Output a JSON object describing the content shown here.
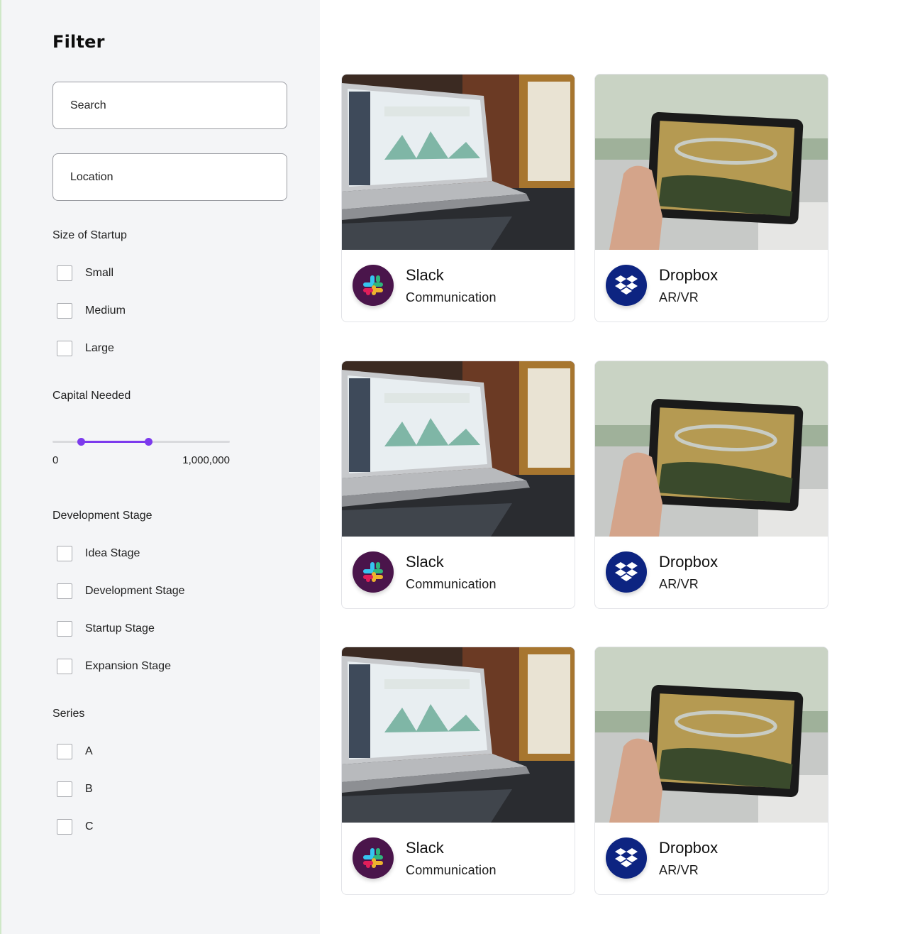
{
  "filter": {
    "title": "Filter",
    "search_placeholder": "Search",
    "location_placeholder": "Location"
  },
  "size_section": {
    "label": "Size of Startup",
    "options": [
      "Small",
      "Medium",
      "Large"
    ]
  },
  "capital_section": {
    "label": "Capital Needed",
    "min_label": "0",
    "max_label": "1,000,000",
    "selected_low_fraction": 0.16,
    "selected_high_fraction": 0.54,
    "accent_color": "#7c3aed"
  },
  "stage_section": {
    "label": "Development Stage",
    "options": [
      "Idea Stage",
      "Development Stage",
      "Startup Stage",
      "Expansion Stage"
    ]
  },
  "series_section": {
    "label": "Series",
    "options": [
      "A",
      "B",
      "C"
    ]
  },
  "cards": [
    {
      "name": "Slack",
      "category": "Communication",
      "logo": "slack-logo",
      "image": "laptop-dashboard-photo"
    },
    {
      "name": "Dropbox",
      "category": "AR/VR",
      "logo": "dropbox-logo",
      "image": "tablet-ar-photo"
    },
    {
      "name": "Slack",
      "category": "Communication",
      "logo": "slack-logo",
      "image": "laptop-dashboard-photo"
    },
    {
      "name": "Dropbox",
      "category": "AR/VR",
      "logo": "dropbox-logo",
      "image": "tablet-ar-photo"
    },
    {
      "name": "Slack",
      "category": "Communication",
      "logo": "slack-logo",
      "image": "laptop-dashboard-photo"
    },
    {
      "name": "Dropbox",
      "category": "AR/VR",
      "logo": "dropbox-logo",
      "image": "tablet-ar-photo"
    }
  ],
  "colors": {
    "slack_logo_bg": "#4a154b",
    "dropbox_logo_bg": "#0d2481"
  }
}
